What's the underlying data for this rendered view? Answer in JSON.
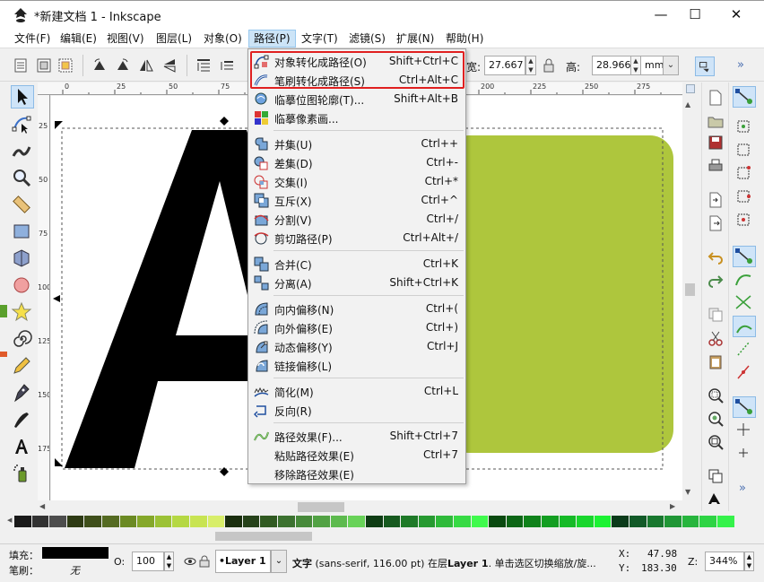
{
  "window": {
    "title": "*新建文档 1 - Inkscape",
    "controls": {
      "minimize": "—",
      "maximize": "☐",
      "close": "✕"
    }
  },
  "menubar": {
    "items": [
      {
        "label": "文件(F)"
      },
      {
        "label": "编辑(E)"
      },
      {
        "label": "视图(V)"
      },
      {
        "label": "图层(L)"
      },
      {
        "label": "对象(O)"
      },
      {
        "label": "路径(P)",
        "active": true
      },
      {
        "label": "文字(T)"
      },
      {
        "label": "滤镜(S)"
      },
      {
        "label": "扩展(N)"
      },
      {
        "label": "帮助(H)"
      }
    ]
  },
  "toolbar": {
    "width_label_fragment": "宽:",
    "width_value": "27.667",
    "height_label": "高:",
    "height_value": "28.966",
    "unit": "mm",
    "overflow": "»"
  },
  "ruler": {
    "top_labels": [
      "0",
      "25",
      "50",
      "75",
      "100",
      "125",
      "150",
      "175",
      "200",
      "225",
      "250",
      "275"
    ],
    "left_labels": [
      "25",
      "50",
      "75",
      "100",
      "125",
      "150",
      "175"
    ]
  },
  "canvas": {
    "glyph": "A",
    "glyph_color": "#000000",
    "rect_color": "#aec63d"
  },
  "path_menu": {
    "items": [
      {
        "label": "对象转化成路径(O)",
        "shortcut": "Shift+Ctrl+C",
        "icon": "object-to-path-icon"
      },
      {
        "label": "笔刷转化成路径(S)",
        "shortcut": "Ctrl+Alt+C",
        "icon": "stroke-to-path-icon"
      },
      {
        "label": "临摹位图轮廓(T)...",
        "shortcut": "Shift+Alt+B",
        "icon": "trace-bitmap-icon"
      },
      {
        "label": "临摹像素画...",
        "shortcut": "",
        "icon": "trace-pixel-art-icon"
      },
      {
        "label": "并集(U)",
        "shortcut": "Ctrl++",
        "icon": "union-icon"
      },
      {
        "label": "差集(D)",
        "shortcut": "Ctrl+-",
        "icon": "difference-icon"
      },
      {
        "label": "交集(I)",
        "shortcut": "Ctrl+*",
        "icon": "intersection-icon"
      },
      {
        "label": "互斥(X)",
        "shortcut": "Ctrl+^",
        "icon": "exclusion-icon"
      },
      {
        "label": "分割(V)",
        "shortcut": "Ctrl+/",
        "icon": "division-icon"
      },
      {
        "label": "剪切路径(P)",
        "shortcut": "Ctrl+Alt+/",
        "icon": "cut-path-icon"
      },
      {
        "label": "合并(C)",
        "shortcut": "Ctrl+K",
        "icon": "combine-icon"
      },
      {
        "label": "分离(A)",
        "shortcut": "Shift+Ctrl+K",
        "icon": "break-apart-icon"
      },
      {
        "label": "向内偏移(N)",
        "shortcut": "Ctrl+(",
        "icon": "inset-icon"
      },
      {
        "label": "向外偏移(E)",
        "shortcut": "Ctrl+)",
        "icon": "outset-icon"
      },
      {
        "label": "动态偏移(Y)",
        "shortcut": "Ctrl+J",
        "icon": "dynamic-offset-icon"
      },
      {
        "label": "链接偏移(L)",
        "shortcut": "",
        "icon": "linked-offset-icon"
      },
      {
        "label": "简化(M)",
        "shortcut": "Ctrl+L",
        "icon": "simplify-icon"
      },
      {
        "label": "反向(R)",
        "shortcut": "",
        "icon": "reverse-icon"
      },
      {
        "label": "路径效果(F)...",
        "shortcut": "Shift+Ctrl+7",
        "icon": "path-effects-icon"
      },
      {
        "label": "粘贴路径效果(E)",
        "shortcut": "Ctrl+7",
        "icon": ""
      },
      {
        "label": "移除路径效果(E)",
        "shortcut": "",
        "icon": ""
      }
    ]
  },
  "status": {
    "fill_label": "填充：",
    "fill_color": "#000000",
    "stroke_label": "笔刷：",
    "stroke_value": "无",
    "opacity_label": "O:",
    "opacity_value": "100",
    "layer": "•Layer 1",
    "message_bold": "文字",
    "message_rest": " (sans-serif, 116.00 pt) 在层",
    "message_layer": "Layer 1",
    "message_tail": ". 单击选区切换缩放/旋...",
    "x_label": "X:",
    "x_value": "47.98",
    "y_label": "Y:",
    "y_value": "183.30",
    "zoom_label": "Z:",
    "zoom_value": "344%"
  }
}
